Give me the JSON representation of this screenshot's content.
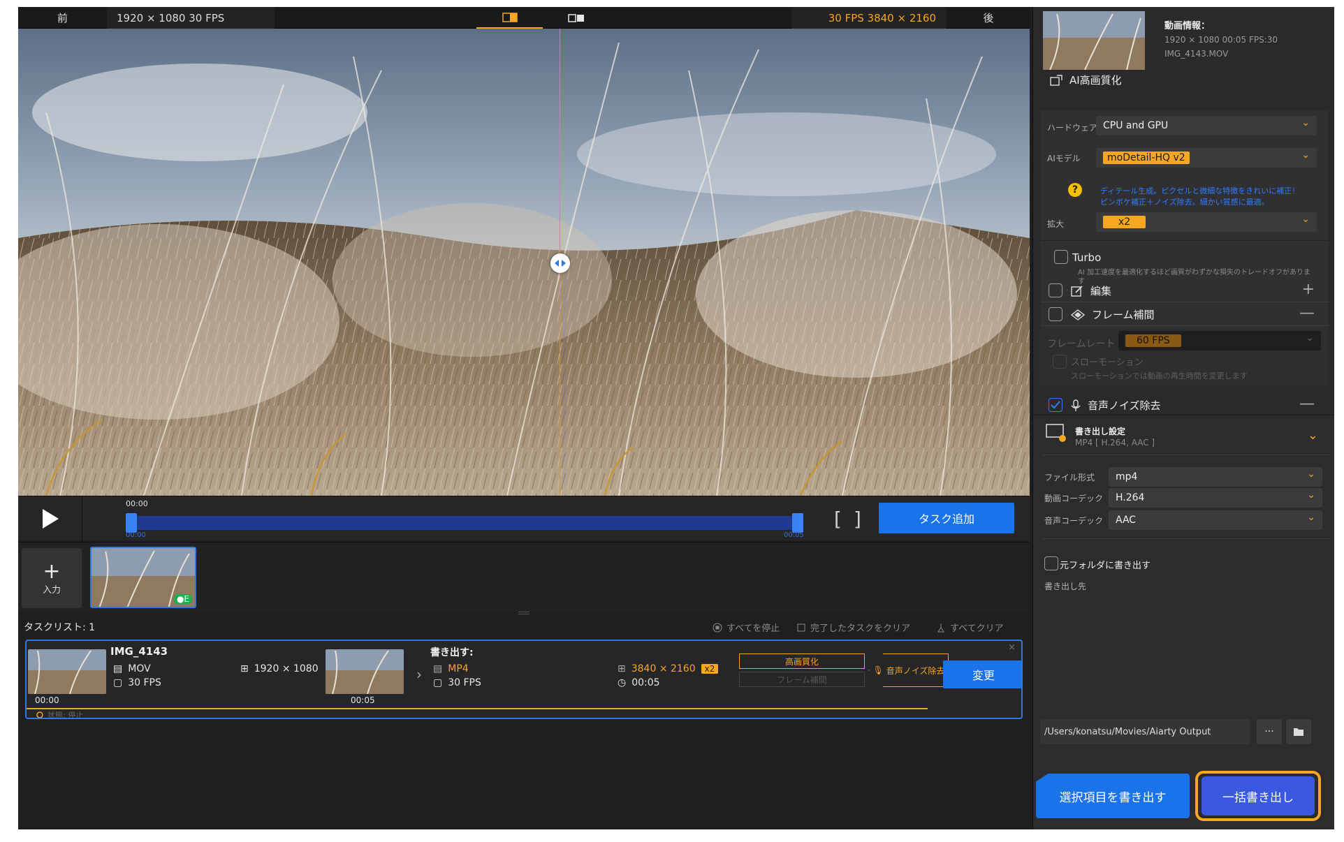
{
  "compare_bar": {
    "before_label": "前",
    "source_info": "1920 × 1080   30 FPS",
    "output_info": "30 FPS   3840 × 2160",
    "after_label": "後"
  },
  "timeline": {
    "current_time": "00:00",
    "range_start": "00:00",
    "range_end": "00:05",
    "bracket_open": "[",
    "bracket_close": "]",
    "add_task_label": "タスク追加"
  },
  "media": {
    "input_label": "入力",
    "badge": "●E"
  },
  "tasklist": {
    "title": "タスクリスト: 1",
    "stop_all": "すべてを停止",
    "clear_done": "完了したタスクをクリア",
    "clear_all": "すべてクリア",
    "task": {
      "name": "IMG_4143",
      "src_format": "MOV",
      "src_resolution": "1920 × 1080",
      "src_fps": "30 FPS",
      "time_start": "00:00",
      "time_end": "00:05",
      "export_label": "書き出す:",
      "out_format": "MP4",
      "out_resolution": "3840 × 2160",
      "out_scale": "x2",
      "out_fps": "30 FPS",
      "out_duration": "00:05",
      "tag_enhance": "高画質化",
      "tag_interp": "フレーム補間",
      "tag_denoise": "音声ノイズ除去",
      "change_label": "変更",
      "close": "×",
      "status": "状態: 停止"
    }
  },
  "right_panel": {
    "info": {
      "title": "動画情報：",
      "meta": "1920 × 1080 00:05 FPS:30",
      "filename": "IMG_4143.MOV"
    },
    "ai": {
      "section_title": "AI高画質化",
      "hardware_label": "ハードウェア",
      "hardware_value": "CPU and GPU",
      "model_label": "AIモデル",
      "model_value": "moDetail-HQ  v2",
      "model_desc_1": "ディテール生成。ピクセルと微細な特徴をきれいに補正！",
      "model_desc_2": "ピンボケ補正＋ノイズ除去。細かい質感に最適。",
      "scale_label": "拡大",
      "scale_value": "x2",
      "turbo_label": "Turbo",
      "turbo_desc": "AI 加工速度を最適化するほど画質がわずかな損失のトレードオフがあります"
    },
    "edit_label": "編集",
    "frame_interp": {
      "label": "フレーム補間",
      "rate_label": "フレームレート",
      "rate_value": "60 FPS",
      "slowmo_label": "スローモーション",
      "slowmo_desc": "スローモーションでは動画の再生時間を変更します"
    },
    "audio_denoise_label": "音声ノイズ除去",
    "export": {
      "title": "書き出し設定",
      "subtitle": "MP4 [ H.264, AAC ]",
      "format_label": "ファイル形式",
      "format_value": "mp4",
      "vcodec_label": "動画コーデック",
      "vcodec_value": "H.264",
      "acodec_label": "音声コーデック",
      "acodec_value": "AAC",
      "orig_folder_label": "元フォルダに書き出す",
      "dest_label": "書き出し先",
      "dest_path": "/Users/konatsu/Movies/Aiarty Output",
      "more": "···",
      "export_selected": "選択項目を書き出す",
      "export_all": "一括書き出し"
    }
  },
  "colors": {
    "accent": "#f5a623",
    "primary_blue": "#1a73e8",
    "panel_bg": "#2a2a2c"
  }
}
